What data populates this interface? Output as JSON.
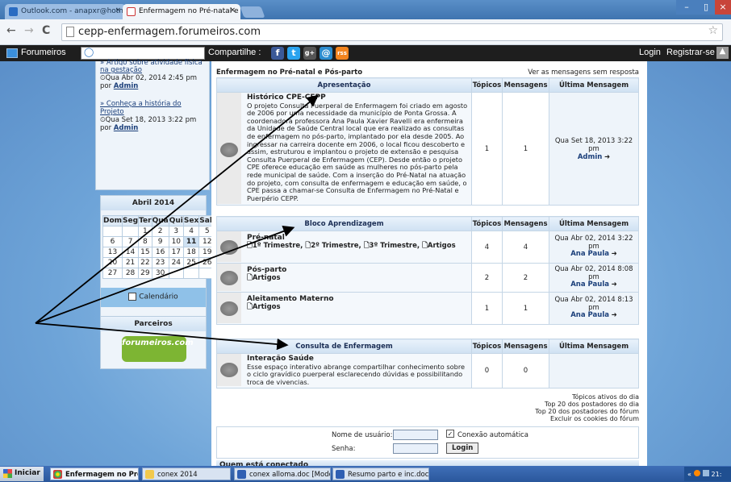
{
  "browser": {
    "tabs": [
      {
        "label": "Outlook.com - anapxr@hotm"
      },
      {
        "label": "Enfermagem no Pré-natal e P"
      }
    ],
    "tab_close": "×",
    "url": "cepp-enfermagem.forumeiros.com",
    "window_controls": [
      "–",
      "▯",
      "×"
    ]
  },
  "forumbar": {
    "brand": "Forumeiros",
    "share_label": "Compartilhe :",
    "login": "Login",
    "register": "Registrar-se",
    "social": [
      "f",
      "t",
      "g+",
      "@",
      "rss"
    ]
  },
  "sidebar": {
    "recent_cut": "» Artigo sobre atividade física",
    "recent": [
      {
        "title": "na gestação",
        "date": "⏲Qua Abr 02, 2014 2:45 pm",
        "by": "por",
        "author": "Admin"
      },
      {
        "title": "» Conheça a história do Projeto",
        "date": "⏲Qua Set 18, 2013 3:22 pm",
        "by": "por",
        "author": "Admin"
      }
    ],
    "calendar": {
      "title": "Abril 2014",
      "days": [
        "Dom",
        "Seg",
        "Ter",
        "Qua",
        "Qui",
        "Sex",
        "Sab"
      ],
      "weeks": [
        [
          "",
          "",
          "1",
          "2",
          "3",
          "4",
          "5"
        ],
        [
          "6",
          "7",
          "8",
          "9",
          "10",
          "11",
          "12"
        ],
        [
          "13",
          "14",
          "15",
          "16",
          "17",
          "18",
          "19"
        ],
        [
          "20",
          "21",
          "22",
          "23",
          "24",
          "25",
          "26"
        ],
        [
          "27",
          "28",
          "29",
          "30",
          "",
          "",
          ""
        ]
      ],
      "today": "11",
      "link": "Calendário"
    },
    "partners": {
      "title": "Parceiros",
      "logo_text": "forumeiros.com"
    }
  },
  "main": {
    "breadcrumb": "Enfermagem no Pré-natal e Pós-parto",
    "unread_link": "Ver as mensagens sem resposta",
    "headers": {
      "topics": "Tópicos",
      "messages": "Mensagens",
      "last": "Última Mensagem"
    },
    "categories": [
      {
        "title": "Apresentação",
        "forums": [
          {
            "name": "Histórico CPE-CEPP",
            "desc": "O projeto Consulta Puerperal de Enfermagem foi criado em agosto de 2006 por uma necessidade da município de Ponta Grossa. A coordenadora professora Ana Paula Xavier Ravelli era enfermeira da Unidade de Saúde Central local que era realizado as consultas de enfermagem no pós-parto, implantado por ela desde 2005. Ao ingressar na carreira docente em 2006, o local ficou descoberto e assim, estruturou e implantou o projeto de extensão e pesquisa Consulta Puerperal de Enfermagem (CEP). Desde então o projeto CPE oferece educação em saúde as mulheres no pós-parto pela rede municipal de saúde. Com a inserção do Pré-Natal na atuação do projeto, com consulta de enfermagem e educação em saúde, o CPE passa a chamar-se Consulta de Enfermagem no Pré-Natal e Puerpério CEPP.",
            "topics": "1",
            "messages": "1",
            "last_date": "Qua Set 18, 2013 3:22 pm",
            "last_author": "Admin"
          }
        ]
      },
      {
        "title": "Bloco Aprendizagem",
        "forums": [
          {
            "name": "Pré-natal",
            "sub": "🗋1º Trimestre, 🗋2º Trimestre, 🗋3º Trimestre, 🗋Artigos",
            "topics": "4",
            "messages": "4",
            "last_date": "Qua Abr 02, 2014 3:22 pm",
            "last_author": "Ana Paula"
          },
          {
            "name": "Pós-parto",
            "sub": "🗋Artigos",
            "topics": "2",
            "messages": "2",
            "last_date": "Qua Abr 02, 2014 8:08 pm",
            "last_author": "Ana Paula"
          },
          {
            "name": "Aleitamento Materno",
            "sub": "🗋Artigos",
            "topics": "1",
            "messages": "1",
            "last_date": "Qua Abr 02, 2014 8:13 pm",
            "last_author": "Ana Paula"
          }
        ]
      },
      {
        "title": "Consulta de Enfermagem",
        "forums": [
          {
            "name": "Interação Saúde",
            "desc": "Esse espaço interativo abrange compartilhar conhecimento sobre o ciclo gravídico puerperal esclarecendo dúvidas e possibilitando troca de vivencias.",
            "topics": "0",
            "messages": "0"
          }
        ]
      }
    ],
    "footer_links": [
      "Tópicos ativos do dia",
      "Top 20 dos postadores do dia",
      "Top 20 dos postadores do fórum",
      "Excluir os cookies do fórum"
    ],
    "login": {
      "user_label": "Nome de usuário:",
      "pass_label": "Senha:",
      "auto_label": "Conexão automática",
      "button": "Login"
    },
    "who_online": "Quem está conectado"
  },
  "taskbar": {
    "start": "Iniciar",
    "items": [
      "Enfermagem no Pré-n...",
      "conex 2014",
      "conex alloma.doc [Modo ...",
      "Resumo parto e inc.doc [..."
    ],
    "clock": "21:"
  },
  "colors": {
    "accent": "#1b3f7a",
    "header_bg": "#cfe1f2",
    "page_bg": "#6fa3d3"
  }
}
